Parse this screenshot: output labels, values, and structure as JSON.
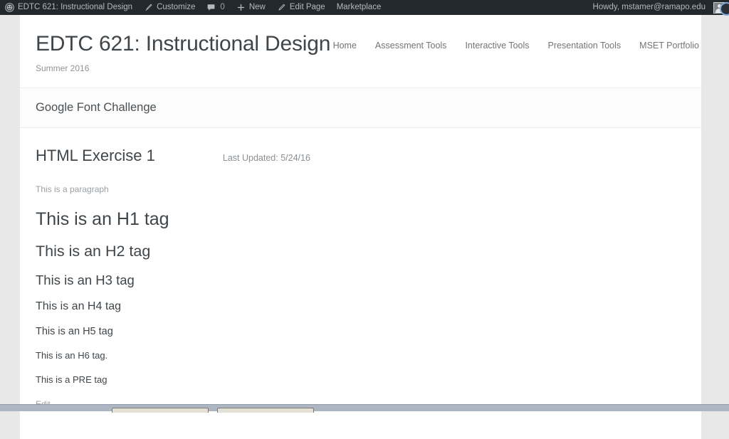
{
  "admin_bar": {
    "site_name": "EDTC 621: Instructional Design",
    "site_icon": "wordpress-logo-icon",
    "customize": {
      "label": "Customize",
      "icon": "paintbrush-icon"
    },
    "comments": {
      "count": "0",
      "icon": "comment-bubble-icon"
    },
    "new": {
      "label": "New",
      "icon": "plus-icon"
    },
    "edit_page": {
      "label": "Edit Page",
      "icon": "pencil-icon"
    },
    "marketplace": {
      "label": "Marketplace"
    },
    "account": {
      "greeting": "Howdy, mstamer@ramapo.edu",
      "avatar": "user-avatar-icon"
    }
  },
  "site_header": {
    "title": "EDTC 621: Instructional Design",
    "description": "Summer 2016",
    "nav": [
      {
        "label": "Home"
      },
      {
        "label": "Assessment Tools"
      },
      {
        "label": "Interactive Tools"
      },
      {
        "label": "Presentation Tools"
      },
      {
        "label": "MSET Portfolio"
      }
    ]
  },
  "page_title_bar": {
    "title": "Google Font Challenge"
  },
  "content": {
    "entry_title": "HTML Exercise 1",
    "last_updated": "Last Updated: 5/24/16",
    "paragraph": "This is a paragraph",
    "headings": [
      {
        "tag": "h1",
        "text": "This is an H1 tag"
      },
      {
        "tag": "h2",
        "text": "This is an H2 tag"
      },
      {
        "tag": "h3",
        "text": "This is an H3 tag"
      },
      {
        "tag": "h4",
        "text": "This is an H4 tag"
      },
      {
        "tag": "h5",
        "text": "This is an H5 tag"
      },
      {
        "tag": "h6",
        "text": "This is an H6 tag."
      }
    ],
    "pre_text": "This is a PRE tag",
    "edit_link": "Edit"
  },
  "colors": {
    "admin_bar_bg": "#23282d",
    "admin_bar_text": "#b4b9be",
    "page_bg": "#e8e8e8",
    "container_bg": "#ffffff",
    "title_bar_bg": "#fcfcfc",
    "heading_text": "#3f4549",
    "muted_text": "#9aa0a4",
    "nav_text": "#6f7579",
    "border": "#ececec",
    "taskbar_bg": "#aeb6c4"
  }
}
